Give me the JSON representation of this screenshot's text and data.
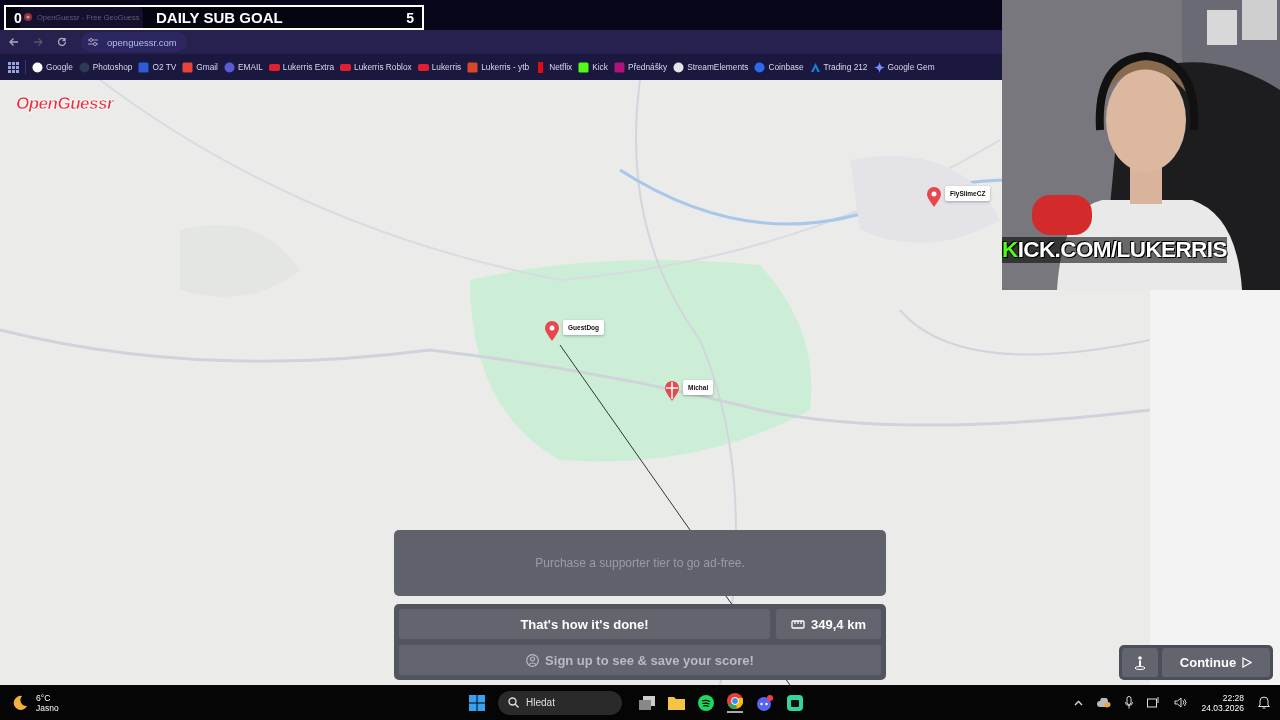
{
  "stream_overlay": {
    "goal_current": "0",
    "goal_title": "DAILY SUB GOAL",
    "goal_target": "5",
    "channel": "KICK.COM/LUKERRIS"
  },
  "browser": {
    "tab": {
      "title": "OpenGuessr - Free GeoGuess"
    },
    "url": "openguessr.com",
    "bookmarks": [
      {
        "label": "Google",
        "kind": "google"
      },
      {
        "label": "Photoshop",
        "kind": "photoshop"
      },
      {
        "label": "O2 TV",
        "kind": "tv"
      },
      {
        "label": "Gmail",
        "kind": "mail"
      },
      {
        "label": "EMAIL",
        "kind": "at"
      },
      {
        "label": "Lukerris Extra",
        "kind": "video"
      },
      {
        "label": "Lukerris Roblox",
        "kind": "video"
      },
      {
        "label": "Lukerris",
        "kind": "video"
      },
      {
        "label": "Lukerris - ytb",
        "kind": "chart"
      },
      {
        "label": "Netflix",
        "kind": "netflix"
      },
      {
        "label": "Kick",
        "kind": "kick"
      },
      {
        "label": "Přednášky",
        "kind": "lectures"
      },
      {
        "label": "StreamElements",
        "kind": "anchor"
      },
      {
        "label": "Coinbase",
        "kind": "coin"
      },
      {
        "label": "Trading 212",
        "kind": "trading"
      },
      {
        "label": "Google Gem",
        "kind": "spark"
      }
    ]
  },
  "game": {
    "logo": "OpenGuessr",
    "players": [
      {
        "name": "FlySlimeCZ",
        "kind": "plain"
      },
      {
        "name": "GuestDog",
        "kind": "plain"
      },
      {
        "name": "Michal",
        "kind": "marked"
      }
    ],
    "ad_notice": "Purchase a supporter tier to go ad-free.",
    "result": "That's how it's done!",
    "distance": "349,4 km",
    "signup": "Sign up to see & save your score!",
    "continue": "Continue"
  },
  "taskbar": {
    "temperature": "6°C",
    "weather": "Jasno",
    "search_placeholder": "Hledat",
    "time": "22:28",
    "date": "24.03.2026"
  }
}
